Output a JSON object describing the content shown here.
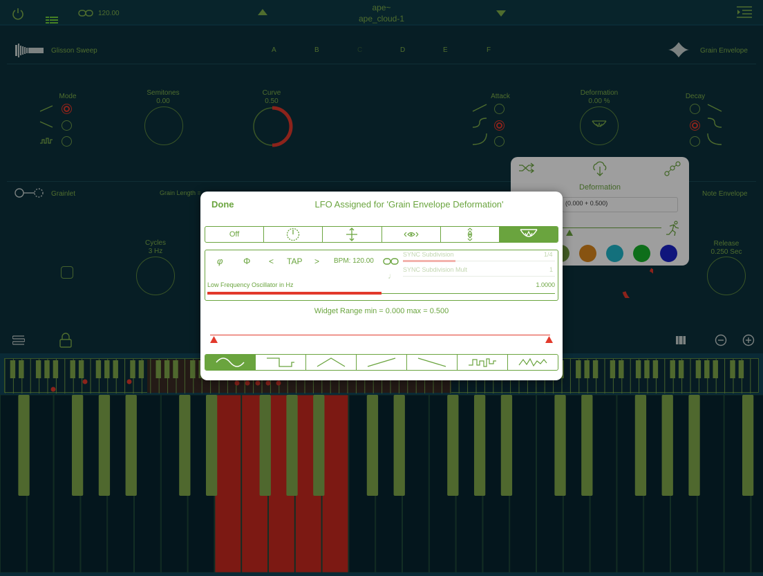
{
  "topbar": {
    "bpm_value": "120.00",
    "preset_line1": "ape~",
    "preset_line2": "ape_cloud-1"
  },
  "top_section": {
    "left_title": "Glisson Sweep",
    "letters": [
      "A",
      "B",
      "C",
      "D",
      "E",
      "F"
    ],
    "right_title": "Grain Envelope",
    "mode_label": "Mode",
    "semitones_label": "Semitones",
    "semitones_value": "0.00",
    "curve_label": "Curve",
    "curve_value": "0.50",
    "curve_level": 0.5,
    "attack_label": "Attack",
    "deformation_label": "Deformation",
    "deformation_value": "0.00 %",
    "decay_label": "Decay"
  },
  "mid_section": {
    "left_title": "Grainlet",
    "grain_length_label": "Grain Length =",
    "right_title": "Note Envelope",
    "cycles_label": "Cycles",
    "cycles_value": "3 Hz",
    "release_label": "Release",
    "release_value": "0.250 Sec"
  },
  "popover": {
    "title": "Deformation",
    "expression": "(0.000 + 0.500)",
    "colors": [
      "#6f9a3e",
      "#d9861c",
      "#1fb4c8",
      "#17b22a",
      "#1a22c8"
    ]
  },
  "dialog": {
    "done_label": "Done",
    "title": "LFO Assigned for 'Grain Envelope Deformation'",
    "target_tabs": [
      "Off",
      "clock-dial",
      "vertical-arrows",
      "horizontal-eye",
      "vertical-eye",
      "grain-envelope"
    ],
    "selected_target": 5,
    "phase_symbol_1": "φ",
    "phase_symbol_2": "Φ",
    "prev_label": "<",
    "tap_label": "TAP",
    "next_label": ">",
    "bpm_label": "BPM: 120.00",
    "sync_subdivision_label": "SYNC Subdivision",
    "sync_subdivision_value": "1/4",
    "sync_mult_label": "SYNC Subdivision Mult",
    "sync_mult_value": "1",
    "note_glyph": "♩",
    "lfo_label": "Low Frequency Oscillator in Hz",
    "lfo_value": "1.0000",
    "lfo_level": 0.5,
    "range_text": "Widget Range min = 0.000 max = 0.500",
    "waveforms": [
      "sine",
      "square",
      "triangle",
      "saw-up",
      "saw-down",
      "sample-hold",
      "random"
    ],
    "selected_waveform": 0
  }
}
